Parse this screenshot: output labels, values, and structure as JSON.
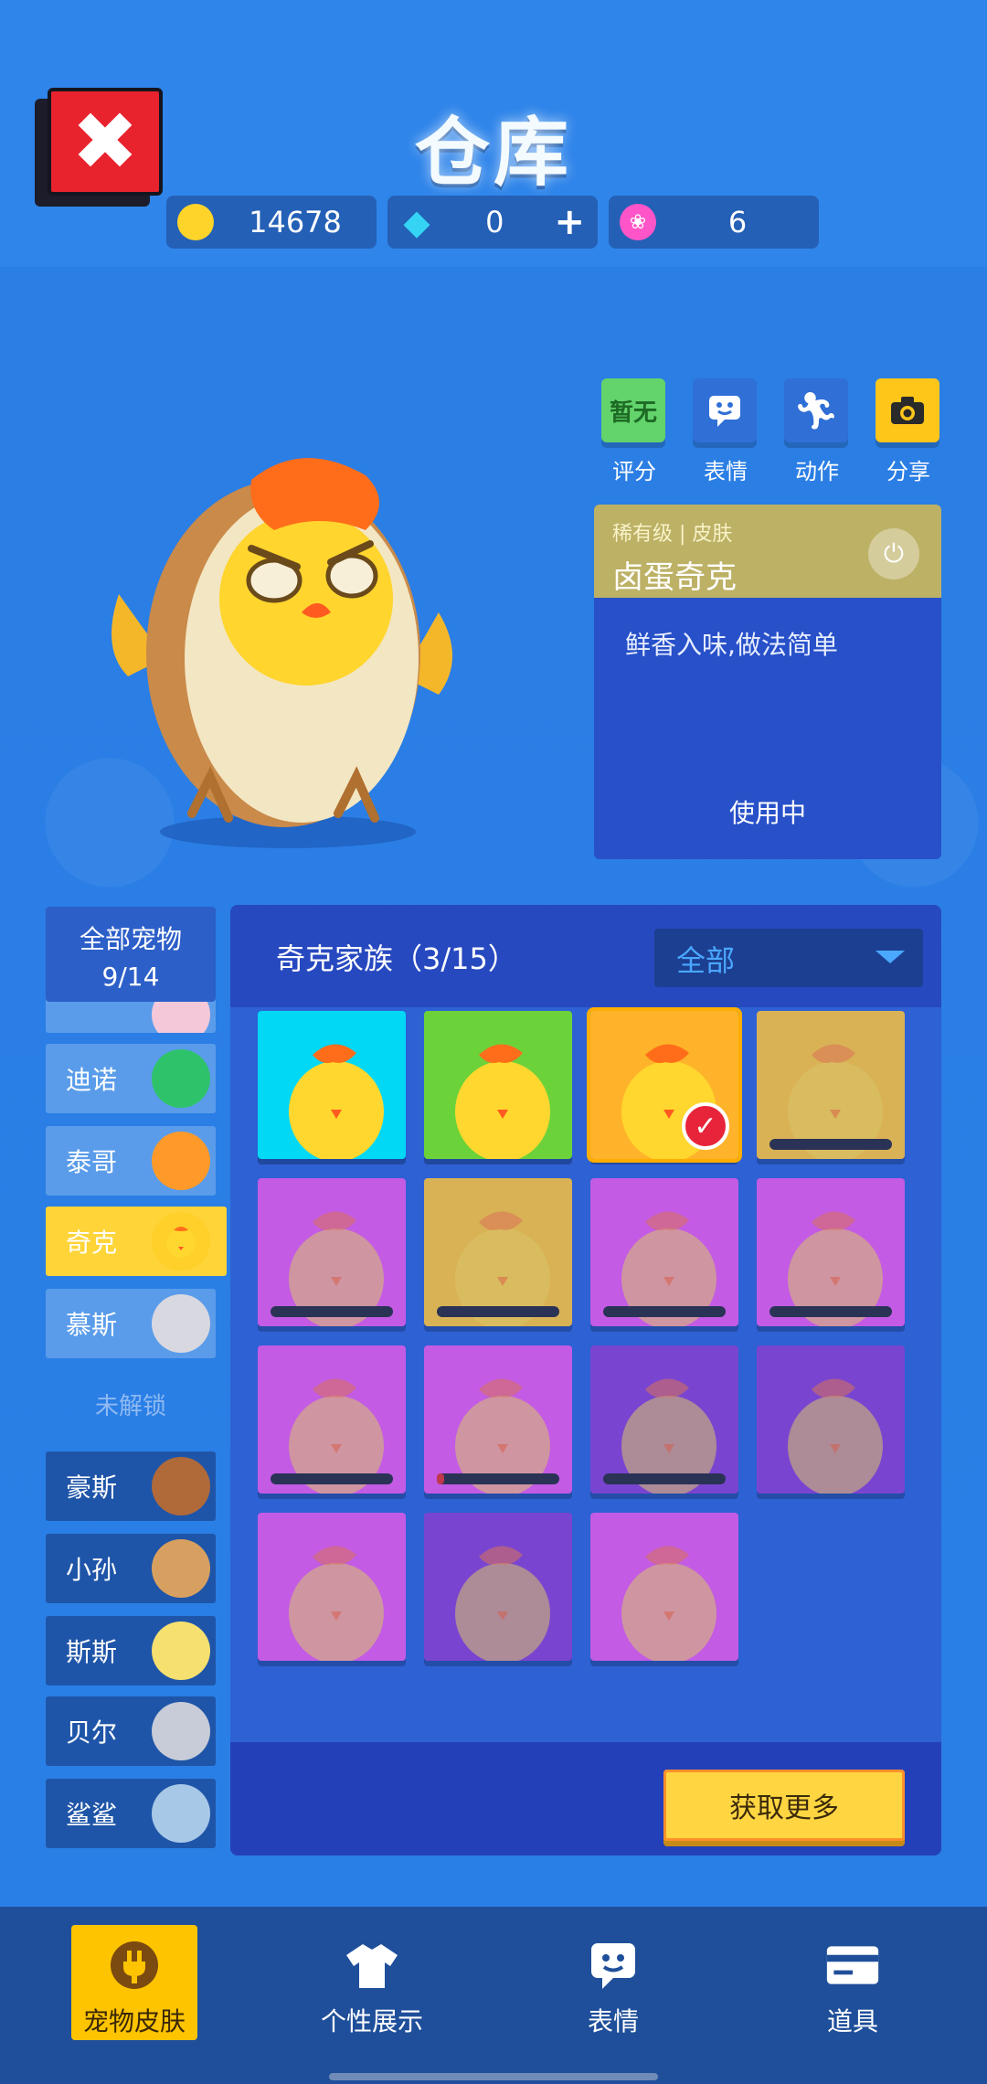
{
  "header": {
    "title": "仓库",
    "close_icon": "close-icon"
  },
  "currencies": [
    {
      "name": "coin",
      "icon": "coin-icon",
      "value": "14678",
      "color": "#ffd42a"
    },
    {
      "name": "diamond",
      "icon": "diamond-icon",
      "value": "0",
      "has_plus": true,
      "color": "#35d4f5"
    },
    {
      "name": "lotus",
      "icon": "lotus-icon",
      "value": "6",
      "color": "#ff55c8"
    }
  ],
  "actions": [
    {
      "label": "评分",
      "box_text": "暂无",
      "color": "#63d36c",
      "icon": "rating-icon"
    },
    {
      "label": "表情",
      "box_text": "",
      "color": "#2f6fd6",
      "icon": "emote-icon"
    },
    {
      "label": "动作",
      "box_text": "",
      "color": "#2f6fd6",
      "icon": "motion-icon"
    },
    {
      "label": "分享",
      "box_text": "",
      "color": "#ffc61a",
      "icon": "camera-icon"
    }
  ],
  "skin_card": {
    "rarity": "稀有级 | 皮肤",
    "name": "卤蛋奇克",
    "description": "鲜香入味,做法简单",
    "status": "使用中",
    "plug_icon": "plug-icon"
  },
  "pet_list": {
    "title": "全部宠物",
    "count": "9/14",
    "unlocked": [
      {
        "name": "迪诺",
        "avatar": "dinosaur-icon",
        "color": "#2ec36a"
      },
      {
        "name": "泰哥",
        "avatar": "tiger-icon",
        "color": "#ff9a2a"
      },
      {
        "name": "奇克",
        "avatar": "chick-icon",
        "color": "#ffcf2a",
        "selected": true
      },
      {
        "name": "慕斯",
        "avatar": "mouse-icon",
        "color": "#d8d8e0"
      }
    ],
    "locked_label": "未解锁",
    "locked": [
      {
        "name": "豪斯",
        "avatar": "horse-icon",
        "color": "#b06a3a"
      },
      {
        "name": "小孙",
        "avatar": "monkey-icon",
        "color": "#d8a060"
      },
      {
        "name": "斯斯",
        "avatar": "snake-icon",
        "color": "#f5e070"
      },
      {
        "name": "贝尔",
        "avatar": "bear-icon",
        "color": "#c8ccd8"
      },
      {
        "name": "鲨鲨",
        "avatar": "shark-icon",
        "color": "#a8c8e8"
      }
    ]
  },
  "skin_panel": {
    "title": "奇克家族（3/15）",
    "filter": "全部",
    "get_more": "获取更多",
    "skins": [
      {
        "color": "#00d8f5",
        "owned": true
      },
      {
        "color": "#6cd23a",
        "owned": true
      },
      {
        "color": "#ffb32a",
        "owned": true,
        "equipped": true
      },
      {
        "color": "#ffc43a",
        "owned": false,
        "progress": 0
      },
      {
        "color": "#e45ae8",
        "owned": false,
        "progress": 0
      },
      {
        "color": "#ffc43a",
        "owned": false,
        "progress": 0
      },
      {
        "color": "#e45ae8",
        "owned": false,
        "progress": 0
      },
      {
        "color": "#e45ae8",
        "owned": false,
        "progress": 0
      },
      {
        "color": "#e45ae8",
        "owned": false,
        "progress": 0
      },
      {
        "color": "#e45ae8",
        "owned": false,
        "progress": 0.06
      },
      {
        "color": "#8a3fd0",
        "owned": false,
        "progress": 0
      },
      {
        "color": "#8a3fd0",
        "owned": false
      },
      {
        "color": "#e45ae8",
        "owned": false
      },
      {
        "color": "#8a3fd0",
        "owned": false
      },
      {
        "color": "#e45ae8",
        "owned": false
      }
    ]
  },
  "bottom_nav": [
    {
      "label": "宠物皮肤",
      "icon": "plug-icon",
      "active": true
    },
    {
      "label": "个性展示",
      "icon": "shirt-icon",
      "active": false
    },
    {
      "label": "表情",
      "icon": "emote-icon",
      "active": false
    },
    {
      "label": "道具",
      "icon": "card-icon",
      "active": false
    }
  ]
}
